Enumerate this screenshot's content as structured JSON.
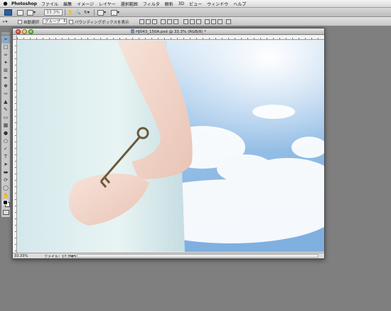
{
  "menubar": {
    "app_name": "Photoshop",
    "menus": [
      "ファイル",
      "編集",
      "イメージ",
      "レイヤー",
      "選択範囲",
      "フィルタ",
      "解析",
      "3D",
      "ビュー",
      "ウィンドウ",
      "ヘルプ"
    ]
  },
  "appbar": {
    "logo": "Ps",
    "zoom_value": "33.3%"
  },
  "options_bar": {
    "auto_select_label": "自動選択",
    "group_value": "グループ",
    "bounding_box_label": "バウンディングボックスを表示"
  },
  "document": {
    "title": "HJ043_150A.psd @ 33.3% (RGB/8) *",
    "status_zoom": "33.33%",
    "status_file": "ファイル：17.7M/51.4M"
  },
  "colors": {
    "foreground": "#000000",
    "background": "#ffffff",
    "accent": "#2c5f9e"
  },
  "icons": {
    "tools": [
      "move-tool-icon",
      "marquee-tool-icon",
      "lasso-tool-icon",
      "quick-select-tool-icon",
      "crop-tool-icon",
      "eyedropper-tool-icon",
      "healing-brush-tool-icon",
      "brush-tool-icon",
      "clone-stamp-tool-icon",
      "history-brush-tool-icon",
      "eraser-tool-icon",
      "gradient-tool-icon",
      "blur-tool-icon",
      "dodge-tool-icon",
      "pen-tool-icon",
      "type-tool-icon",
      "path-select-tool-icon",
      "shape-tool-icon",
      "3d-rotate-tool-icon",
      "3d-orbit-tool-icon",
      "hand-tool-icon",
      "zoom-tool-icon"
    ]
  }
}
